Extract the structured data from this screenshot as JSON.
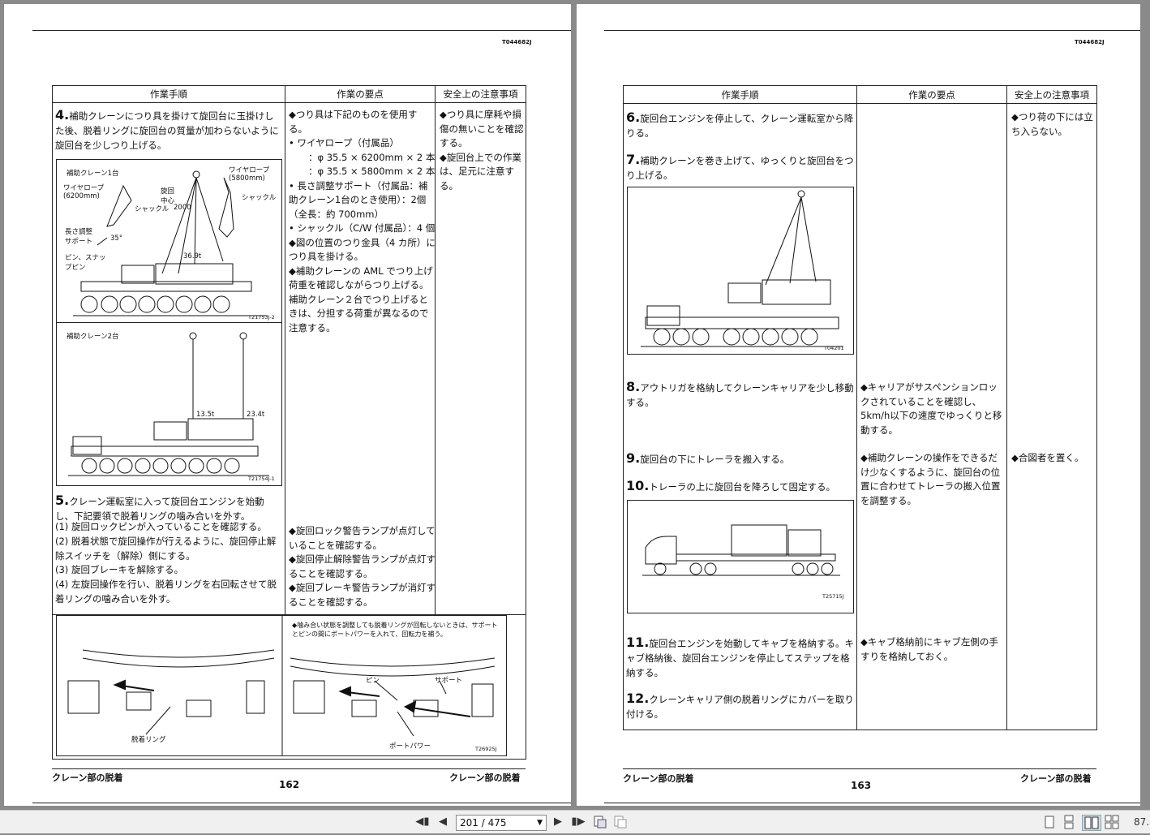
{
  "left": {
    "doc_id": "T044682J",
    "header": [
      "作業手順",
      "作業の要点",
      "安全上の注意事項"
    ],
    "step4": {
      "num": "4.",
      "text": "補助クレーンにつり具を掛けて旋回台に玉掛けした後、脱着リングに旋回台の質量が加わらないように旋回台を少しつり上げる。"
    },
    "fig1": {
      "id": "T21753J-2",
      "labels": [
        "補助クレーン1台",
        "ワイヤロープ (6200mm)",
        "旋回中心",
        "シャックル",
        "2000",
        "ワイヤロープ (5800mm)",
        "シャックル",
        "長さ調整サポート",
        "ピン、スナップピン",
        "36.9t",
        "35°"
      ]
    },
    "fig2": {
      "id": "T21754J-1",
      "labels": [
        "補助クレーン2台",
        "13.5t",
        "23.4t"
      ]
    },
    "points4": [
      "◆つり具は下記のものを使用する。",
      "• ワイヤロープ（付属品）",
      "：φ 35.5 × 6200mm × 2 本",
      "：φ 35.5 × 5800mm × 2 本",
      "• 長さ調整サポート（付属品：補助クレーン1台のとき使用）：2個（全長：約 700mm）",
      "• シャックル（C/W 付属品）：4 個",
      "◆図の位置のつり金具（4 カ所）につり具を掛ける。",
      "◆補助クレーンの AML でつり上げ荷重を確認しながらつり上げる。",
      "補助クレーン２台でつり上げるときは、分担する荷重が異なるので注意する。"
    ],
    "safety4": [
      "◆つり具に摩耗や損傷の無いことを確認する。",
      "◆旋回台上での作業は、足元に注意する。"
    ],
    "step5": {
      "num": "5.",
      "text": "クレーン運転室に入って旋回台エンジンを始動し、下記要領で脱着リングの噛み合いを外す。",
      "subs": [
        "(1) 旋回ロックピンが入っていることを確認する。",
        "(2) 脱着状態で旋回操作が行えるように、旋回停止解除スイッチを（解除）側にする。",
        "(3) 旋回ブレーキを解除する。",
        "(4) 左旋回操作を行い、脱着リングを右回転させて脱着リングの噛み合いを外す。"
      ]
    },
    "points5": [
      "◆旋回ロック警告ランプが点灯していることを確認する。",
      "◆旋回停止解除警告ランプが点灯することを確認する。",
      "◆旋回ブレーキ警告ランプが消灯することを確認する。"
    ],
    "fig3": {
      "id": "T26925J",
      "note": "◆噛み合い状態を調整しても脱着リングが回転しないときは、サポートとピンの間にポートパワーを入れて、回転力を補う。",
      "labels": [
        "脱着リング",
        "ピン",
        "サポート",
        "ポートパワー"
      ]
    },
    "footer_left": "クレーン部の脱着",
    "footer_right": "クレーン部の脱着",
    "page_no": "162"
  },
  "right": {
    "doc_id": "T044682J",
    "header": [
      "作業手順",
      "作業の要点",
      "安全上の注意事項"
    ],
    "step6": {
      "num": "6.",
      "text": "旋回台エンジンを停止して、クレーン運転室から降りる。"
    },
    "step7": {
      "num": "7.",
      "text": "補助クレーンを巻き上げて、ゆっくりと旋回台をつり上げる。"
    },
    "fig4": {
      "id": "T04201"
    },
    "safety67": "◆つり荷の下には立ち入らない。",
    "step8": {
      "num": "8.",
      "text": "アウトリガを格納してクレーンキャリアを少し移動する。"
    },
    "points8": "◆キャリアがサスペンションロックされていることを確認し、5km/h以下の速度でゆっくりと移動する。",
    "step9": {
      "num": "9.",
      "text": "旋回台の下にトレーラを搬入する。"
    },
    "step10": {
      "num": "10.",
      "text": "トレーラの上に旋回台を降ろして固定する。"
    },
    "points9": "◆補助クレーンの操作をできるだけ少なくするように、旋回台の位置に合わせてトレーラの搬入位置を調整する。",
    "safety9": "◆合図者を置く。",
    "fig5": {
      "id": "T25715J"
    },
    "step11": {
      "num": "11.",
      "text": "旋回台エンジンを始動してキャブを格納する。キャブ格納後、旋回台エンジンを停止してステップを格納する。"
    },
    "points11": "◆キャブ格納前にキャブ左側の手すりを格納しておく。",
    "step12": {
      "num": "12.",
      "text": "クレーンキャリア側の脱着リングにカバーを取り付ける。"
    },
    "footer_left": "クレーン部の脱着",
    "footer_right": "クレーン部の脱着",
    "page_no": "163"
  },
  "toolbar": {
    "page_indicator": "201 / 475",
    "zoom": "87.",
    "icons": [
      "first-page-icon",
      "prev-page-icon",
      "next-page-icon",
      "last-page-icon",
      "fit-page-icon",
      "fit-width-icon",
      "single-page-icon",
      "continuous-icon",
      "two-page-icon",
      "two-page-continuous-icon"
    ]
  }
}
